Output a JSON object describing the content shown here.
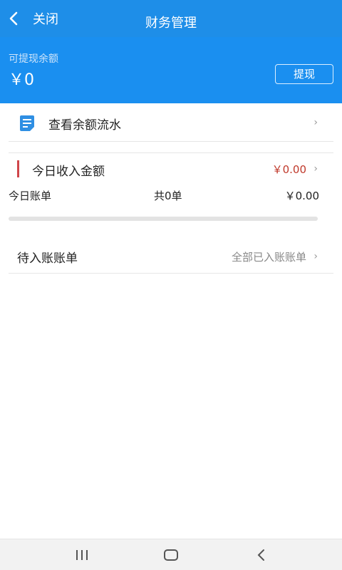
{
  "navbar": {
    "back_icon": "chevron-left-icon",
    "close_label": "关闭",
    "title": "财务管理"
  },
  "balance": {
    "label": "可提现余额",
    "value": "￥0",
    "withdraw_label": "提现"
  },
  "flow_row": {
    "icon": "document-icon",
    "label": "查看余额流水",
    "chevron": "›"
  },
  "income_row": {
    "label": "今日收入金额",
    "amount": "￥0.00",
    "chevron": "›"
  },
  "bills": {
    "label": "今日账单",
    "count": "共0单",
    "amount": "￥0.00",
    "progress": 0
  },
  "pending_row": {
    "label": "待入账账单",
    "link": "全部已入账账单",
    "chevron": "›"
  },
  "system_nav": {
    "recent_icon": "recent-apps-icon",
    "home_icon": "home-icon",
    "back_icon": "back-icon"
  },
  "colors": {
    "header": "#1a8ff0",
    "accent_red": "#c0392b"
  }
}
